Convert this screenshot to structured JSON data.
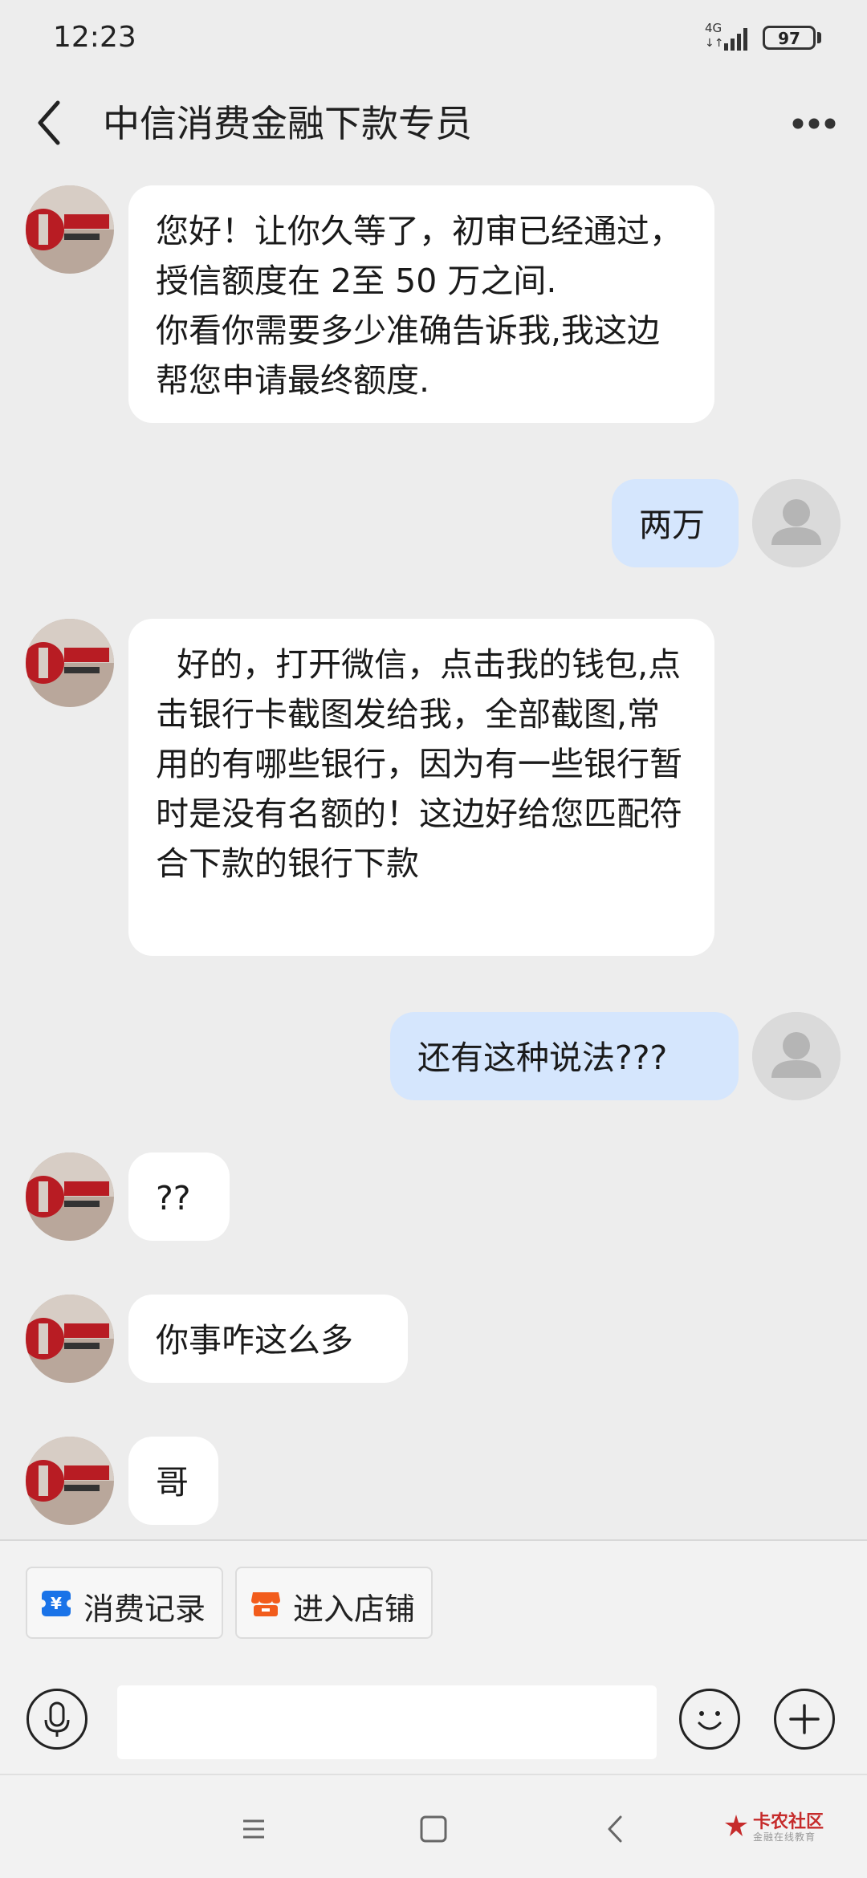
{
  "status_bar": {
    "time": "12:23",
    "network": "4G",
    "network_arrows": "↓↑",
    "battery": "97"
  },
  "header": {
    "title": "中信消费金融下款专员",
    "back_icon": "chevron-left-icon",
    "more_icon": "more-dots-icon"
  },
  "messages": [
    {
      "side": "in",
      "text": "您好！让你久等了，初审已经通过，授信额度在 2至 50 万之间.\n你看你需要多少准确告诉我,我这边帮您申请最终额度."
    },
    {
      "side": "out",
      "text": "两万"
    },
    {
      "side": "in",
      "text": "  好的，打开微信，点击我的钱包,点击银行卡截图发给我，全部截图,常用的有哪些银行，因为有一些银行暂时是没有名额的！这边好给您匹配符合下款的银行下款"
    },
    {
      "side": "out",
      "text": "还有这种说法???"
    },
    {
      "side": "in",
      "text": "??"
    },
    {
      "side": "in",
      "text": "你事咋这么多"
    },
    {
      "side": "in",
      "text": "哥"
    }
  ],
  "quick_actions": [
    {
      "label": "消费记录",
      "icon": "receipt-yen-icon",
      "color": "#1a73e8"
    },
    {
      "label": "进入店铺",
      "icon": "store-icon",
      "color": "#f25c1c"
    }
  ],
  "input": {
    "placeholder": ""
  },
  "watermark": {
    "title": "卡农社区",
    "subtitle": "金融在线教育"
  },
  "colors": {
    "bubble_out": "#d5e6fd",
    "bubble_in": "#ffffff",
    "background": "#ededed"
  }
}
